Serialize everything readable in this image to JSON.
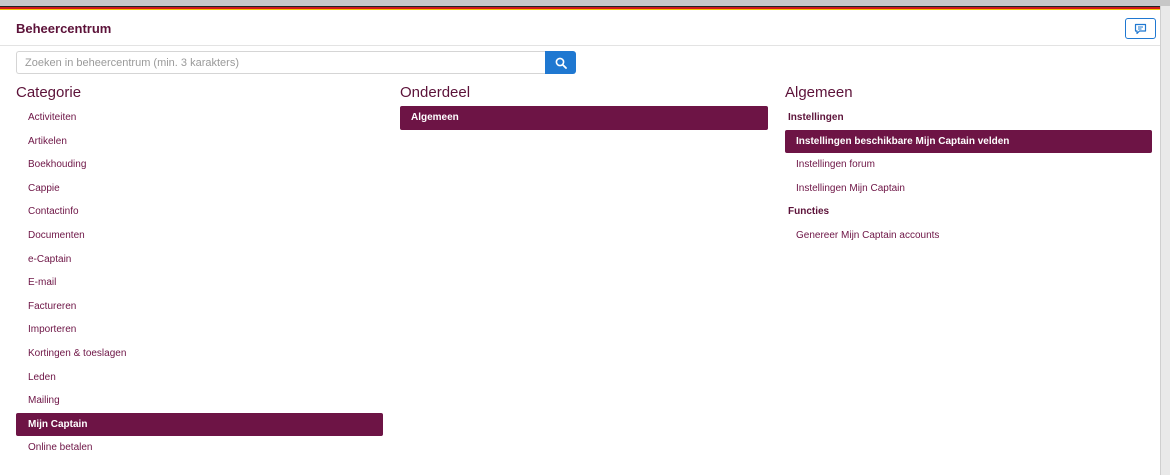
{
  "header": {
    "title": "Beheercentrum",
    "feedback_icon": "comment-icon"
  },
  "colors": {
    "primary": "#6d1445",
    "accent_blue": "#1f78d1"
  },
  "search": {
    "placeholder": "Zoeken in beheercentrum (min. 3 karakters)",
    "value": "",
    "button_icon": "search-icon"
  },
  "categorie": {
    "title": "Categorie",
    "items": [
      "Activiteiten",
      "Artikelen",
      "Boekhouding",
      "Cappie",
      "Contactinfo",
      "Documenten",
      "e-Captain",
      "E-mail",
      "Factureren",
      "Importeren",
      "Kortingen & toeslagen",
      "Leden",
      "Mailing",
      "Mijn Captain",
      "Online betalen"
    ],
    "selected": "Mijn Captain"
  },
  "onderdeel": {
    "title": "Onderdeel",
    "items": [
      "Algemeen"
    ],
    "selected": "Algemeen"
  },
  "algemeen": {
    "title": "Algemeen",
    "groups": [
      {
        "heading": "Instellingen",
        "items": [
          "Instellingen beschikbare Mijn Captain velden",
          "Instellingen forum",
          "Instellingen Mijn Captain"
        ]
      },
      {
        "heading": "Functies",
        "items": [
          "Genereer Mijn Captain accounts"
        ]
      }
    ],
    "selected": "Instellingen beschikbare Mijn Captain velden"
  }
}
